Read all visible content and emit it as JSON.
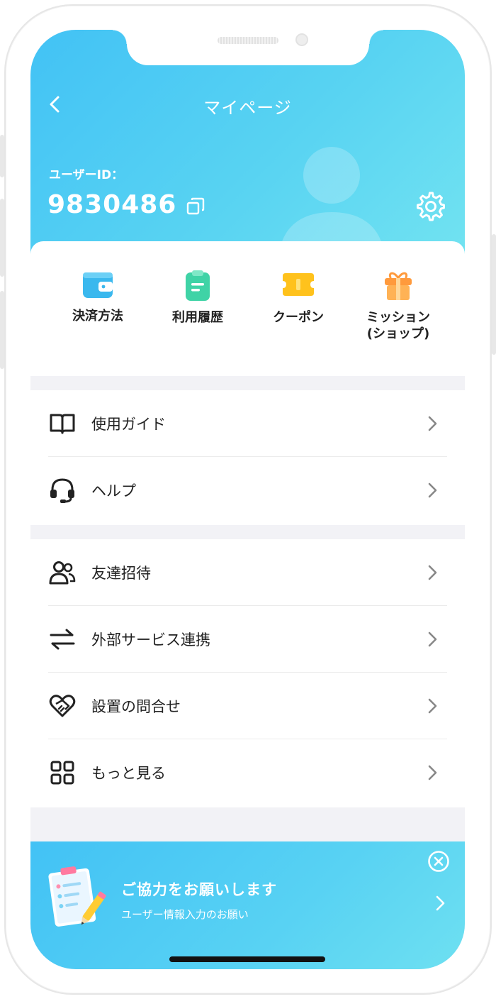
{
  "header": {
    "title": "マイページ",
    "user_id_label": "ユーザーID：",
    "user_id": "9830486"
  },
  "quick_actions": [
    {
      "label": "決済方法",
      "icon": "wallet-icon",
      "color": "#3ab8ee"
    },
    {
      "label": "利用履歴",
      "icon": "clipboard-icon",
      "color": "#3fd3a6"
    },
    {
      "label": "クーポン",
      "icon": "ticket-icon",
      "color": "#ffc21c"
    },
    {
      "label": "ミッション\n(ショップ)",
      "icon": "gift-icon",
      "color": "#ff9a3c"
    }
  ],
  "menu_group_1": [
    {
      "label": "使用ガイド",
      "icon": "book-icon"
    },
    {
      "label": "ヘルプ",
      "icon": "headset-icon"
    }
  ],
  "menu_group_2": [
    {
      "label": "友達招待",
      "icon": "users-icon"
    },
    {
      "label": "外部サービス連携",
      "icon": "swap-arrows-icon"
    },
    {
      "label": "設置の問合せ",
      "icon": "heart-handshake-icon"
    },
    {
      "label": "もっと見る",
      "icon": "grid-icon"
    }
  ],
  "banner": {
    "title": "ご協力をお願いします",
    "subtitle": "ユーザー情報入力のお願い"
  },
  "colors": {
    "header_gradient_start": "#42c2f5",
    "header_gradient_end": "#72e3f1",
    "background": "#f2f2f6"
  }
}
